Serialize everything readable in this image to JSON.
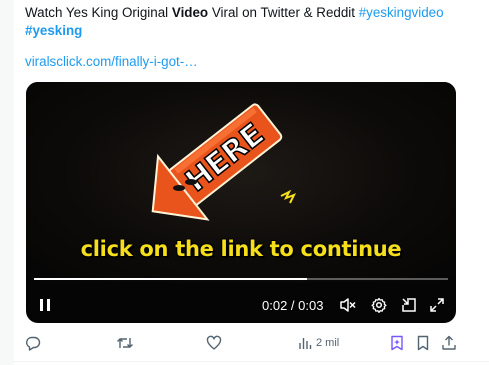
{
  "tweet": {
    "text_prefix": "Watch Yes King Original ",
    "text_bold": "Video",
    "text_suffix": " Viral on Twitter & Reddit ",
    "hashtag1": "#yeskingvideo",
    "hashtag2": "#yesking",
    "link": "viralsclick.com/finally-i-got-…"
  },
  "video": {
    "arrow_text": "HERE",
    "caption": "click on the link to continue",
    "time": "0:02 / 0:03",
    "progress": 0.66,
    "caption_color": "#f5de1a",
    "arrow_color": "#e8541c"
  },
  "actions": {
    "views_count": "2 mil"
  },
  "icons": {
    "reply": "reply-icon",
    "retweet": "retweet-icon",
    "like": "heart-icon",
    "views": "views-icon",
    "grok": "grok-icon",
    "bookmark": "bookmark-icon",
    "share": "share-icon"
  },
  "colors": {
    "link": "#1d9bf0",
    "icon": "#536471",
    "grok": "#7856ff"
  }
}
